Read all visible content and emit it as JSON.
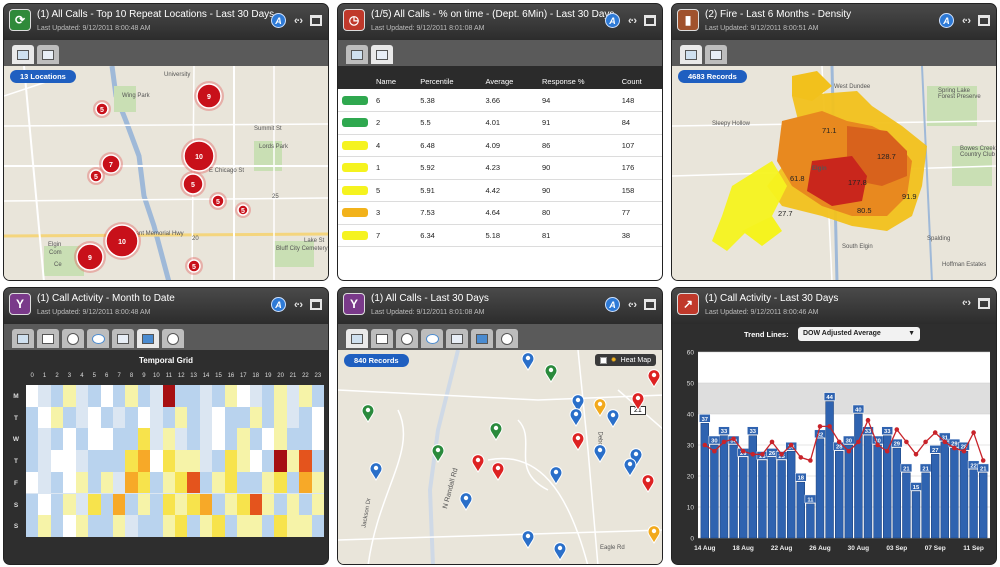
{
  "panels": [
    {
      "title": "(1) All Calls - Top 10 Repeat Locations - Last 30 Days",
      "updated": "Last Updated: 9/12/2011 8:00:48 AM",
      "pill": "13 Locations",
      "icon_color": "#2f8a3a",
      "icon_glyph": "⟳"
    },
    {
      "title": "(1/5) All Calls - % on time - (Dept. 6Min) - Last 30 Days",
      "updated": "Last Updated: 9/12/2011 8:01:08 AM",
      "icon_color": "#c0392b",
      "icon_glyph": "◷"
    },
    {
      "title": "(2) Fire - Last 6 Months - Density",
      "updated": "Last Updated: 9/12/2011 8:00:51 AM",
      "pill": "4683 Records",
      "icon_color": "#a0522d",
      "icon_glyph": "▮"
    },
    {
      "title": "(1) Call Activity - Month to Date",
      "updated": "Last Updated: 9/12/2011 8:00:48 AM",
      "icon_color": "#7a3a8a",
      "icon_glyph": "Y"
    },
    {
      "title": "(1) All Calls - Last 30 Days",
      "updated": "Last Updated: 9/12/2011 8:01:08 AM",
      "pill": "840 Records",
      "icon_color": "#7a3a8a",
      "icon_glyph": "Y",
      "heatmap_label": "Heat Map"
    },
    {
      "title": "(1) Call Activity - Last 30 Days",
      "updated": "Last Updated: 9/12/2011 8:00:46 AM",
      "icon_color": "#c0392b",
      "icon_glyph": "↗",
      "trend_label": "Trend Lines:",
      "trend_value": "DOW Adjusted Average"
    }
  ],
  "controls": {
    "a_label": "A",
    "arrows": "‹·›"
  },
  "map1": {
    "labels": [
      "Wing Park",
      "University",
      "Summit St",
      "Lords Park",
      "Grant Memorial Hwy",
      "Bluff City Cemetery",
      "Lake St",
      "E Chicago St",
      "Com",
      "Ce",
      "Elgin",
      "20",
      "25"
    ],
    "clusters": [
      {
        "label": "9"
      },
      {
        "label": "5"
      },
      {
        "label": "10"
      },
      {
        "label": "7"
      },
      {
        "label": "5"
      },
      {
        "label": "5"
      },
      {
        "label": "5"
      },
      {
        "label": "5"
      },
      {
        "label": "10"
      },
      {
        "label": "9"
      },
      {
        "label": "5"
      }
    ]
  },
  "table": {
    "headers": [
      "Name",
      "Percentile",
      "Average",
      "Response %",
      "Count"
    ],
    "rows": [
      {
        "color": "#2fa84f",
        "name": "6",
        "percentile": "5.38",
        "average": "3.66",
        "response": "94",
        "count": "148"
      },
      {
        "color": "#2fa84f",
        "name": "2",
        "percentile": "5.5",
        "average": "4.01",
        "response": "91",
        "count": "84"
      },
      {
        "color": "#f5f31f",
        "name": "4",
        "percentile": "6.48",
        "average": "4.09",
        "response": "86",
        "count": "107"
      },
      {
        "color": "#f5f31f",
        "name": "1",
        "percentile": "5.92",
        "average": "4.23",
        "response": "90",
        "count": "176"
      },
      {
        "color": "#f5f31f",
        "name": "5",
        "percentile": "5.91",
        "average": "4.42",
        "response": "90",
        "count": "158"
      },
      {
        "color": "#f2b21b",
        "name": "3",
        "percentile": "7.53",
        "average": "4.64",
        "response": "80",
        "count": "77"
      },
      {
        "color": "#f5f31f",
        "name": "7",
        "percentile": "6.34",
        "average": "5.18",
        "response": "81",
        "count": "38"
      }
    ]
  },
  "density": {
    "values": [
      "71.1",
      "128.7",
      "61.8",
      "177.8",
      "91.9",
      "27.7",
      "80.5"
    ],
    "labels": [
      "West Dundee",
      "Spring Lake Forest Preserve",
      "Elgin",
      "South Elgin",
      "Spalding",
      "Bowes Creek Country Club",
      "Sleepy Hollow",
      "Hoffman Estates"
    ]
  },
  "temporal": {
    "title": "Temporal Grid",
    "hours": [
      "0",
      "1",
      "2",
      "3",
      "4",
      "5",
      "6",
      "7",
      "8",
      "9",
      "10",
      "11",
      "12",
      "13",
      "14",
      "15",
      "16",
      "17",
      "18",
      "19",
      "20",
      "21",
      "22",
      "23"
    ],
    "days": [
      "M",
      "T",
      "W",
      "T",
      "F",
      "S",
      "S"
    ],
    "palette": [
      "#dbe6f2",
      "#ffffff",
      "#b9d3ee",
      "#f6f3a8",
      "#f7e34c",
      "#f7a928",
      "#e4541d",
      "#a60f12"
    ],
    "grid": [
      [
        1,
        0,
        2,
        3,
        0,
        2,
        1,
        2,
        3,
        2,
        0,
        7,
        2,
        2,
        0,
        2,
        3,
        1,
        0,
        2,
        3,
        0,
        3,
        2
      ],
      [
        2,
        1,
        3,
        2,
        0,
        1,
        2,
        0,
        2,
        1,
        0,
        2,
        3,
        2,
        0,
        1,
        2,
        2,
        3,
        2,
        3,
        0,
        2,
        1
      ],
      [
        2,
        0,
        2,
        1,
        2,
        1,
        1,
        2,
        2,
        4,
        0,
        3,
        0,
        2,
        0,
        1,
        2,
        3,
        2,
        1,
        3,
        2,
        2,
        1
      ],
      [
        2,
        0,
        1,
        1,
        0,
        2,
        2,
        2,
        4,
        5,
        1,
        4,
        3,
        3,
        0,
        2,
        4,
        3,
        1,
        2,
        7,
        3,
        6,
        2
      ],
      [
        1,
        0,
        2,
        1,
        3,
        2,
        3,
        0,
        5,
        4,
        2,
        3,
        4,
        6,
        2,
        3,
        4,
        2,
        2,
        3,
        4,
        2,
        5,
        3
      ],
      [
        2,
        1,
        2,
        3,
        0,
        4,
        2,
        5,
        2,
        3,
        2,
        4,
        3,
        4,
        5,
        2,
        3,
        4,
        6,
        3,
        2,
        3,
        2,
        3
      ],
      [
        2,
        3,
        2,
        1,
        3,
        2,
        2,
        3,
        0,
        2,
        2,
        3,
        4,
        2,
        3,
        4,
        2,
        3,
        3,
        2,
        4,
        3,
        3,
        2
      ]
    ]
  },
  "marker_map": {
    "labels": [
      "N Randall Rd",
      "Jackson Dr",
      "Deborah",
      "Eagle Rd",
      "21"
    ]
  },
  "chart_data": {
    "type": "bar",
    "title": "",
    "xlabel": "",
    "ylabel": "",
    "ylim": [
      0,
      60
    ],
    "yticks": [
      0,
      10,
      20,
      30,
      40,
      50,
      60
    ],
    "xtick_labels": [
      "14 Aug",
      "18 Aug",
      "22 Aug",
      "26 Aug",
      "30 Aug",
      "03 Sep",
      "07 Sep",
      "11 Sep"
    ],
    "values": [
      37,
      30,
      33,
      30,
      26,
      33,
      25,
      26,
      25,
      28,
      18,
      11,
      32,
      44,
      28,
      30,
      40,
      33,
      30,
      33,
      29,
      21,
      15,
      21,
      27,
      31,
      29,
      28,
      22,
      21
    ],
    "trend": [
      30,
      28,
      31,
      32,
      28,
      27,
      27,
      31,
      27,
      30,
      26,
      25,
      36,
      36,
      31,
      28,
      31,
      38,
      30,
      28,
      35,
      31,
      27,
      31,
      34,
      31,
      29,
      28,
      34,
      25
    ],
    "bar_color": "#2f63b0",
    "trend_color": "#c8232a"
  }
}
